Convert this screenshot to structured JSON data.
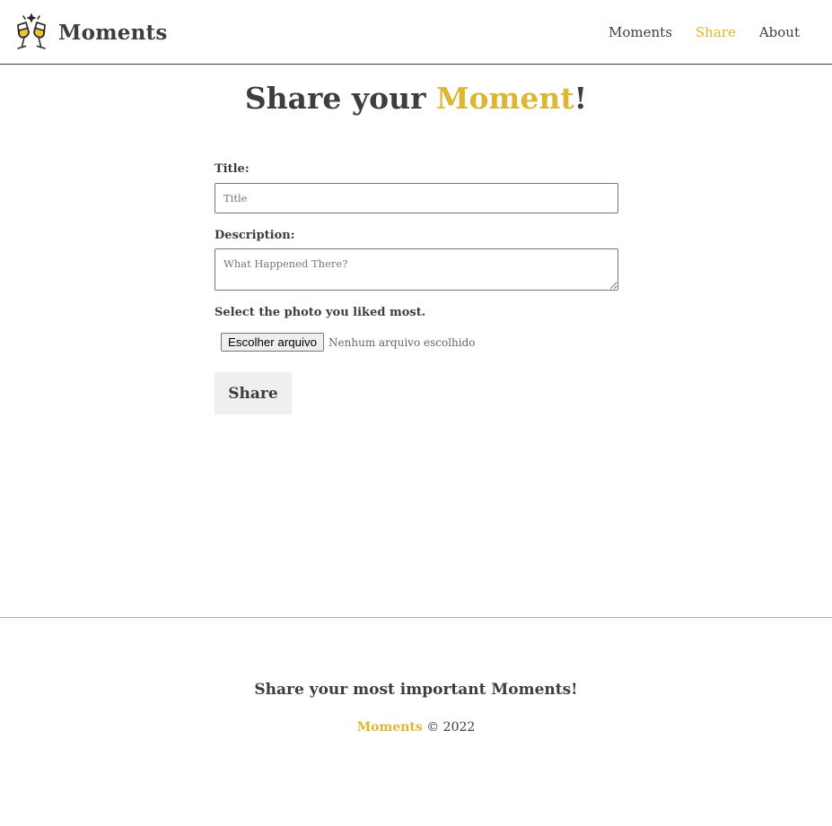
{
  "header": {
    "brand": "Moments",
    "logo_icon": "champagne-toast-icon",
    "nav": [
      {
        "label": "Moments",
        "active": false
      },
      {
        "label": "Share",
        "active": true
      },
      {
        "label": "About",
        "active": false
      }
    ]
  },
  "page": {
    "title_prefix": "Share your ",
    "title_accent": "Moment",
    "title_suffix": "!"
  },
  "form": {
    "title_label": "Title:",
    "title_placeholder": "Title",
    "title_value": "",
    "description_label": "Description:",
    "description_placeholder": "What Happened There?",
    "description_value": "",
    "photo_label": "Select the photo you liked most.",
    "file_button": "Escolher arquivo",
    "file_status": "Nenhum arquivo escolhido",
    "submit_label": "Share"
  },
  "footer": {
    "tagline": "Share your most important Moments!",
    "brand": "Moments",
    "copyright": " © 2022"
  },
  "colors": {
    "accent": "#dbb733",
    "text": "#3d3d3d",
    "button_bg": "#efefef"
  }
}
